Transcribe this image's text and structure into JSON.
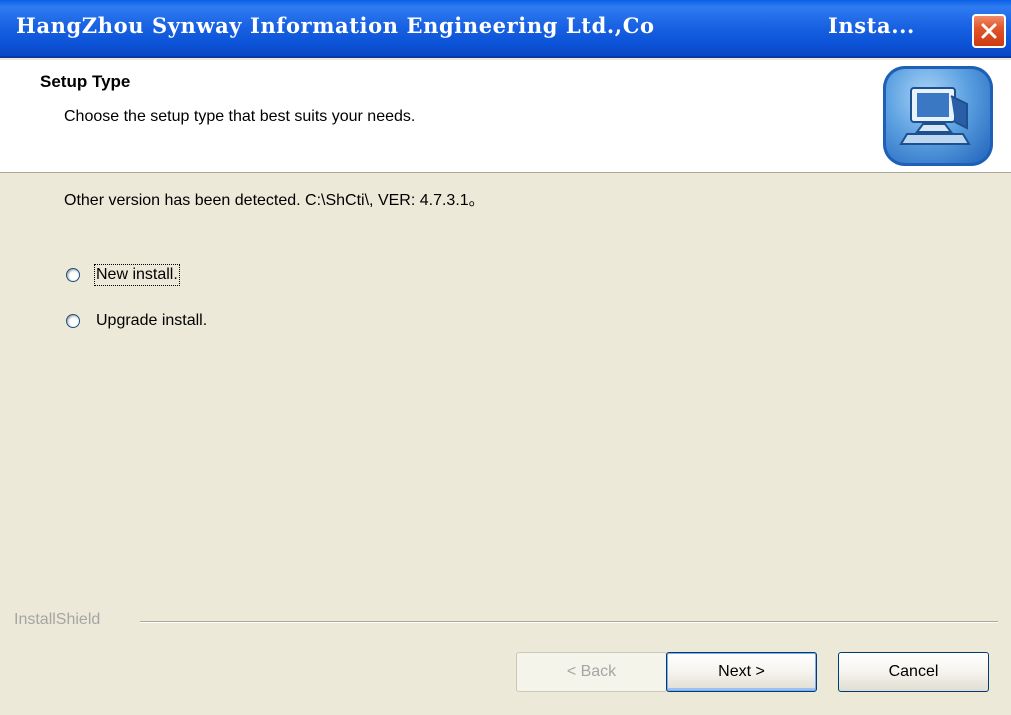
{
  "window": {
    "title": "HangZhou Synway Information Engineering Ltd.,Co",
    "title_suffix": "Insta...",
    "close_icon": "close-icon",
    "titlebar_color": "#0a5fe8",
    "close_color": "#e2562a"
  },
  "header": {
    "title": "Setup Type",
    "subtitle": "Choose the setup type that best suits your needs.",
    "icon": "computer-setup-icon"
  },
  "body": {
    "detected_message": "Other version has been detected. C:\\ShCti\\, VER: 4.7.3.1。",
    "options": [
      {
        "label": "New install.",
        "selected": false,
        "focused": true
      },
      {
        "label": "Upgrade install.",
        "selected": false,
        "focused": false
      }
    ]
  },
  "footer": {
    "brand": "InstallShield",
    "back_label": "< Back",
    "next_label": "Next >",
    "cancel_label": "Cancel"
  }
}
